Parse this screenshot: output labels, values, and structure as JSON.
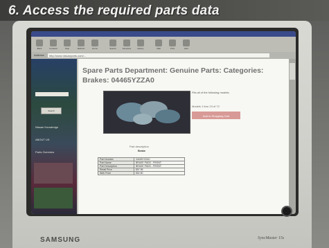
{
  "caption": "6. Access the required parts data",
  "monitor": {
    "brand": "SAMSUNG",
    "model": "SyncMaster 15s"
  },
  "browser": {
    "toolbar": [
      "Back",
      "Forward",
      "Stop",
      "Refresh",
      "Home",
      "Search",
      "Favorites",
      "History",
      "Mail",
      "Print",
      "Edit"
    ],
    "address_label": "Address",
    "address_value": "http://www.nissanparts.com/..."
  },
  "sidebar": {
    "search_button": "Search",
    "links": [
      "Nissan Knowledge",
      "ABOUT US",
      "Parts Overview"
    ]
  },
  "page": {
    "heading": "Spare Parts Department: Genuine Parts: Categories: Brakes: 04465YZZA0",
    "side_text": "Fits all of the following models:",
    "side_link": "Models 1 thru 23 of 72",
    "cart_button": "Add to Shopping Cart",
    "part_desc_label": "Part description",
    "part_desc_value": "Brake",
    "table": [
      {
        "k": "Part Number",
        "v": "04465YZZA0"
      },
      {
        "k": "Part Name",
        "v": "BRAKE PADS - FRONT"
      },
      {
        "k": "Part Description",
        "v": "BRAKE PADS - FRONT"
      },
      {
        "k": "Retail Price",
        "v": "$57.95"
      },
      {
        "k": "Web Price",
        "v": "$52.50"
      }
    ]
  }
}
